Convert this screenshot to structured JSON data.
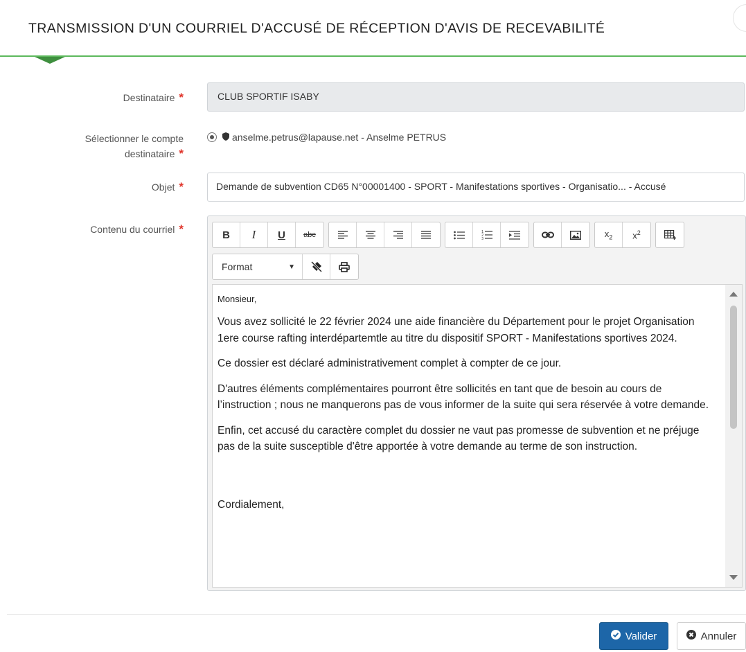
{
  "modal": {
    "title": "TRANSMISSION D'UN COURRIEL D'ACCUSÉ DE RÉCEPTION D'AVIS DE RECEVABILITÉ"
  },
  "form": {
    "destinataire": {
      "label": "Destinataire",
      "required_mark": "*",
      "value": "CLUB SPORTIF ISABY"
    },
    "compte": {
      "label_line1": "Sélectionner le compte",
      "label_line2": "destinataire",
      "required_mark": "*",
      "option": "anselme.petrus@lapause.net - Anselme PETRUS"
    },
    "objet": {
      "label": "Objet",
      "required_mark": "*",
      "value": "Demande de subvention CD65 N°00001400 - SPORT -  Manifestations sportives - Organisatio... - Accusé"
    },
    "contenu": {
      "label": "Contenu du courriel",
      "required_mark": "*"
    }
  },
  "editor": {
    "toolbar_row1": [
      {
        "group": [
          "B",
          "I",
          "U",
          "abc"
        ]
      },
      {
        "group": [
          "align-left-icon",
          "align-center-icon",
          "align-right-icon",
          "align-justify-icon"
        ]
      },
      {
        "group": [
          "bulleted-list-icon",
          "numbered-list-icon",
          "indent-icon"
        ]
      },
      {
        "group": [
          "link-icon",
          "image-icon"
        ]
      },
      {
        "group": [
          "subscript-icon",
          "superscript-icon"
        ]
      },
      {
        "group": [
          "table-icon"
        ]
      }
    ],
    "format_label": "Format",
    "toolbar_row2_icons": [
      "remove-format-icon",
      "print-icon"
    ],
    "body": {
      "greeting": "Monsieur,",
      "p1": "Vous avez sollicité le 22 février 2024 une aide financière du Département pour le projet Organisation 1ere course rafting interdépartemtle au titre du dispositif SPORT - Manifestations sportives 2024.",
      "p2": "Ce dossier est déclaré administrativement complet à compter de ce jour.",
      "p3": "D'autres éléments complémentaires pourront être sollicités en tant que de besoin au cours de l’instruction ; nous ne manquerons pas de vous informer de la suite qui sera réservée à votre demande.",
      "p4": "Enfin, cet accusé du caractère complet du dossier ne vaut pas promesse de subvention et ne préjuge pas de la suite susceptible d'être apportée à votre demande au terme de son instruction.",
      "closing": "Cordialement,"
    }
  },
  "footer": {
    "valider": "Valider",
    "annuler": "Annuler"
  },
  "colors": {
    "accent_green": "#5cb85c",
    "primary_blue": "#1d66a8",
    "required_red": "#e0352b"
  }
}
